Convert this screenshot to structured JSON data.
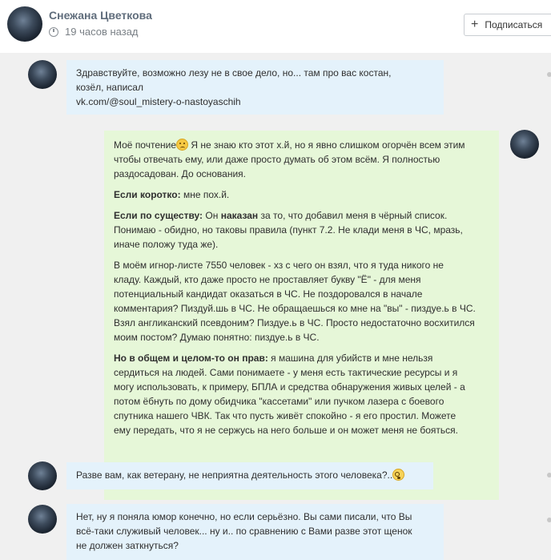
{
  "post_header": {
    "author": "Снежана Цветкова",
    "time": "19 часов назад",
    "subscribe_label": "Подписаться"
  },
  "messages": [
    {
      "side": "left",
      "lines": [
        "Здравствуйте, возможно лезу не в свое дело, но... там про вас костан,",
        "козёл, написал",
        "vk.com/@soul_mistery-o-nastoyaschih"
      ]
    },
    {
      "side": "right",
      "p1_lines": [
        "Моё почтение",
        " Я не знаю кто этот х.й, но я явно слишком огорчён всем этим",
        "чтобы отвечать ему, или даже просто думать об этом всём. Я полностью",
        "раздосадован. До основания."
      ],
      "p2_label": "Если коротко:",
      "p2_text": " мне пох.й.",
      "p3_label": "Если по существу:",
      "p3_text1": "  Он ",
      "p3_bold2": "наказан",
      "p3_text2": " за то, что добавил меня в чёрный список.",
      "p3_lines": [
        "Понимаю - обидно, но таковы правила (пункт 7.2. Не клади меня в ЧС, мразь,",
        "иначе положу туда же)."
      ],
      "p4_lines": [
        "В моём игнор-листе 7550 человек - хз с чего он взял, что я туда никого не",
        "кладу. Каждый, кто даже просто не проставляет букву \"Ё\" - для меня",
        "потенциальный кандидат оказаться в ЧС. Не поздоровался в начале",
        "комментария? Пиздуй.шь в ЧС. Не обращаешься ко мне на \"вы\" - пиздуе.ь в ЧС.",
        "Взял англиканский псевдоним? Пиздуе.ь в ЧС. Просто недостаточно восхитился",
        "моим постом? Думаю понятно: пиздуе.ь в ЧС."
      ],
      "p5_label": "Но в общем и целом-то он прав:",
      "p5_first": " я машина для убийств и мне нельзя",
      "p5_lines": [
        "сердиться на людей. Сами понимаете - у меня есть тактические ресурсы и я",
        "могу использовать, к примеру, БПЛА и средства обнаружения живых целей - а",
        "потом ёбнуть по дому обидчика \"кассетами\" или пучком лазера с боевого",
        "спутника нашего ЧВК. Так что пусть живёт спокойно - я его простил. Можете",
        "ему передать, что я не сержусь на него больше и он может меня не бояться."
      ]
    },
    {
      "side": "left",
      "text": "Разве вам, как ветерану, не неприятна деятельность этого человека?.."
    },
    {
      "side": "left",
      "lines": [
        "Нет, ну я поняла юмор конечно, но если серьёзно. Вы сами писали, что Вы",
        "всё-таки служивый человек... ну и.. по сравнению с Вами разве этот щенок",
        "не должен заткнуться?"
      ]
    }
  ],
  "icons": {
    "clock": "clock-icon",
    "plus": "plus-icon",
    "emoji_sad": "emoji-sad-icon",
    "emoji_flushed": "emoji-flushed-icon"
  },
  "colors": {
    "left_bubble": "#e4f2fb",
    "right_bubble": "#e6f7d8",
    "feed_bg": "#f0f0f0",
    "author_name": "#606d7c"
  }
}
